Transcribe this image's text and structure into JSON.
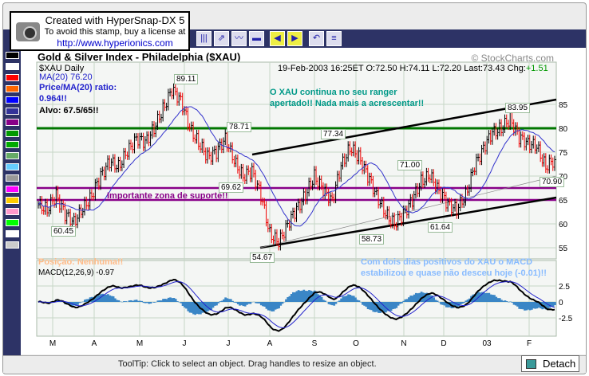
{
  "stamp": {
    "line1": "Created with HyperSnap-DX 5",
    "line2": "To avoid this stamp, buy a license at",
    "line3": "http://www.hyperionics.com"
  },
  "chart": {
    "title": "Gold & Silver Index - Philadelphia ($XAU)",
    "copyright": "© StockCharts.com",
    "symbol": "$XAU Daily",
    "ma": "MA(20) 76.20",
    "quote": "19-Feb-2003 16:25ET  O:72.50  H:74.11  L:72.20  Last:73.43  Chg:",
    "chg": "+1.51",
    "notes": {
      "ratio1": "Price/MA(20) ratio:",
      "ratio2": "0.964!!",
      "alvo": "Alvo: 67.5/65!!",
      "comment1": "O XAU continua no seu ranger",
      "comment2": "apertado!! Nada mais a acrescentar!!",
      "support": "Importante zona de suporte!!",
      "position": "Posição: Nenhuma!!",
      "macd1": "Com dois dias positivos do XAU o MACD",
      "macd2": "estabilizou e quase não desceu hoje (-0.01)!!"
    },
    "price_labels": [
      "89.11",
      "78.71",
      "69.62",
      "60.45",
      "54.67",
      "77.34",
      "58.73",
      "71.00",
      "61.64",
      "83.95",
      "70.90"
    ],
    "macd_label": "MACD(12,26,9) -0.97"
  },
  "chart_data": {
    "type": "line",
    "title": "Gold & Silver Index - Philadelphia ($XAU)",
    "x_ticks": [
      "M",
      "A",
      "M",
      "J",
      "J",
      "A",
      "S",
      "O",
      "N",
      "D",
      "03",
      "F"
    ],
    "y_ticks": [
      85,
      80,
      75,
      70,
      65,
      60,
      55
    ],
    "ylim": [
      53,
      89
    ],
    "macd_ticks": [
      "2.5",
      "0",
      "-2.5"
    ],
    "closes": [
      64,
      63,
      66,
      62,
      60.5,
      63,
      66,
      70,
      73,
      72,
      75,
      78,
      77,
      80,
      84,
      88,
      86,
      80,
      77,
      74,
      75,
      78,
      73,
      70,
      71,
      66,
      58,
      56,
      60,
      63,
      66,
      70,
      67,
      65,
      72,
      76,
      74,
      70,
      66,
      62,
      60,
      62,
      65,
      69,
      70,
      67,
      64,
      63,
      66,
      72,
      76,
      79,
      80,
      82,
      78,
      77,
      76,
      72,
      73.43
    ],
    "support_lines": [
      67.5,
      65
    ],
    "resistance_line": 80
  },
  "status": {
    "tooltip": "ToolTip: Click to select an object. Drag handles to resize an object.",
    "detach": "Detach"
  }
}
